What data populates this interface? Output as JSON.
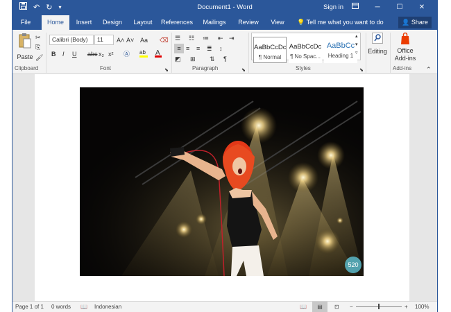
{
  "titlebar": {
    "title": "Document1 - Word",
    "signin": "Sign in",
    "qat": {
      "save": "save-icon",
      "undo": "undo-icon",
      "redo": "redo-icon",
      "customize": "customize-qat-icon"
    }
  },
  "tabs": [
    {
      "label": "File"
    },
    {
      "label": "Home"
    },
    {
      "label": "Insert"
    },
    {
      "label": "Design"
    },
    {
      "label": "Layout"
    },
    {
      "label": "References"
    },
    {
      "label": "Mailings"
    },
    {
      "label": "Review"
    },
    {
      "label": "View"
    }
  ],
  "tellme": "Tell me what you want to do",
  "share": "Share",
  "ribbon": {
    "clipboard": {
      "label": "Clipboard",
      "paste": "Paste"
    },
    "font": {
      "label": "Font",
      "family": "Calibri (Body)",
      "size": "11",
      "grow": "A˄",
      "shrink": "A˅",
      "case": "Aa",
      "bold": "B",
      "italic": "I",
      "underline": "U",
      "strike": "abc",
      "subscript": "x₂",
      "superscript": "x²"
    },
    "paragraph": {
      "label": "Paragraph"
    },
    "styles": {
      "label": "Styles",
      "items": [
        {
          "sample": "AaBbCcDc",
          "name": "¶ Normal"
        },
        {
          "sample": "AaBbCcDc",
          "name": "¶ No Spac..."
        },
        {
          "sample": "AaBbCc",
          "name": "Heading 1"
        }
      ]
    },
    "editing": {
      "label": "Editing"
    },
    "addins": {
      "label": "Add-ins",
      "office": "Office",
      "addins": "Add-ins"
    }
  },
  "photo_badge": "520",
  "statusbar": {
    "page": "Page 1 of 1",
    "words": "0 words",
    "language": "Indonesian",
    "zoom": "100%"
  },
  "colors": {
    "brand": "#2b579a",
    "ribbon": "#f3f3f3",
    "canvas": "#e6e6e6"
  }
}
